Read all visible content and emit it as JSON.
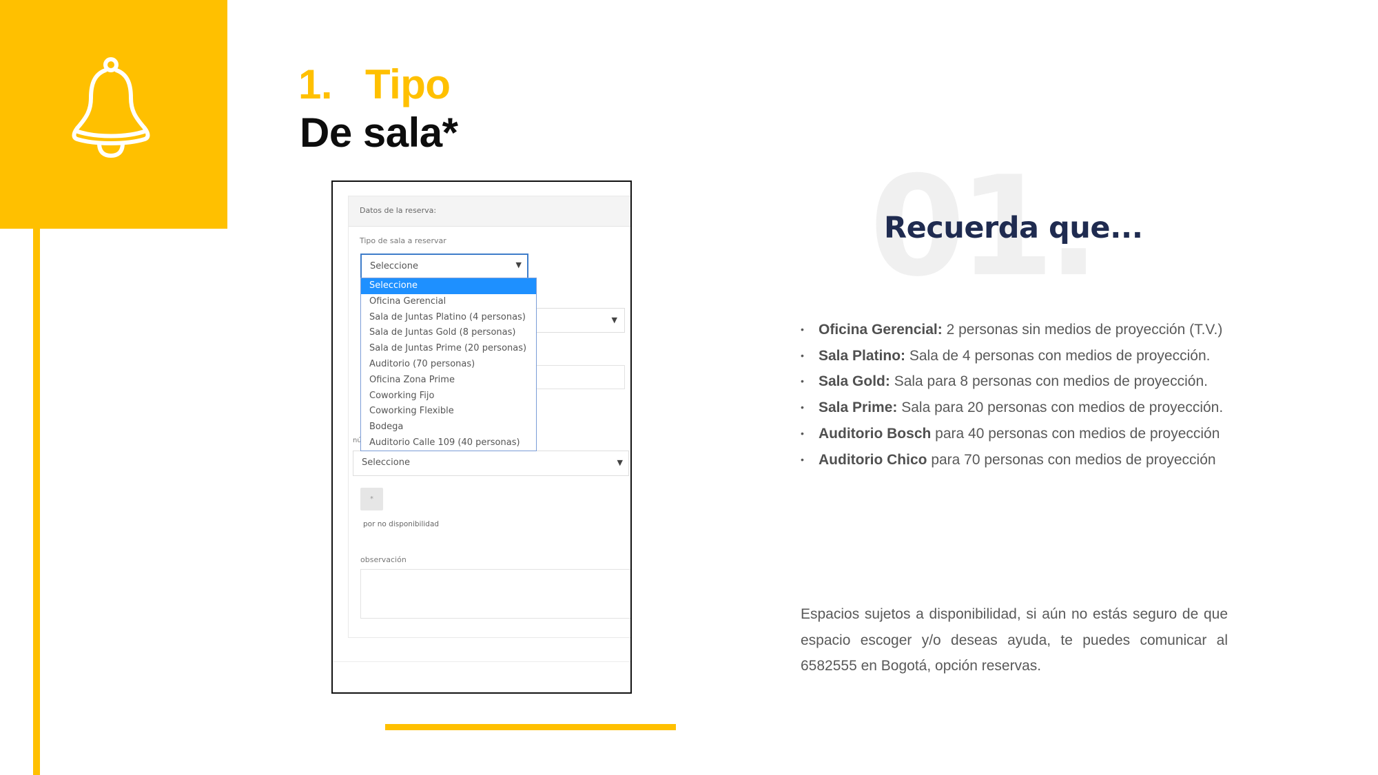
{
  "colors": {
    "accent_yellow": "#FFC000",
    "title_dark": "#0d0d0d",
    "heading_navy": "#1f2b50",
    "body_gray": "#595959",
    "watermark_gray": "#f0f0f0",
    "highlight_blue": "#1e90ff"
  },
  "header": {
    "icon": "bell-icon",
    "title_number": "1.",
    "title_word": "Tipo",
    "subtitle": "De sala*"
  },
  "form_screenshot": {
    "section_title": "Datos de la reserva:",
    "room_type_label": "Tipo de sala a reservar",
    "room_type_select_value": "Seleccione",
    "dropdown_options": [
      "Seleccione",
      "Oficina Gerencial",
      "Sala de Juntas Platino (4 personas)",
      "Sala de Juntas Gold (8 personas)",
      "Sala de Juntas Prime (20 personas)",
      "Auditorio (70 personas)",
      "Oficina Zona Prime",
      "Coworking Fijo",
      "Coworking Flexible",
      "Bodega",
      "Auditorio Calle 109 (40 personas)"
    ],
    "selected_option_index": 0,
    "partial_label": "nú",
    "second_select_value": "Seleccione",
    "mini_button_label": "*",
    "availability_text": "por no disponibilidad",
    "observation_label": "observación",
    "observation_value": ""
  },
  "right_panel": {
    "watermark": "01.",
    "heading": "Recuerda que...",
    "bullets": [
      {
        "bold": "Oficina Gerencial:",
        "text": " 2 personas sin medios de proyección (T.V.)"
      },
      {
        "bold": "Sala Platino:",
        "text": " Sala de 4 personas con medios de proyección."
      },
      {
        "bold": "Sala Gold:",
        "text": " Sala para 8 personas con medios de proyección."
      },
      {
        "bold": "Sala Prime:",
        "text": " Sala para 20 personas con medios de proyección."
      },
      {
        "bold": "Auditorio Bosch",
        "text": " para 40 personas con medios de proyección"
      },
      {
        "bold": "Auditorio Chico",
        "text": " para 70 personas con medios de proyección"
      }
    ],
    "bullet_symbol": "•",
    "note": "Espacios sujetos a disponibilidad, si aún no estás seguro de que espacio escoger y/o deseas ayuda, te puedes comunicar al 6582555 en Bogotá, opción reservas."
  }
}
